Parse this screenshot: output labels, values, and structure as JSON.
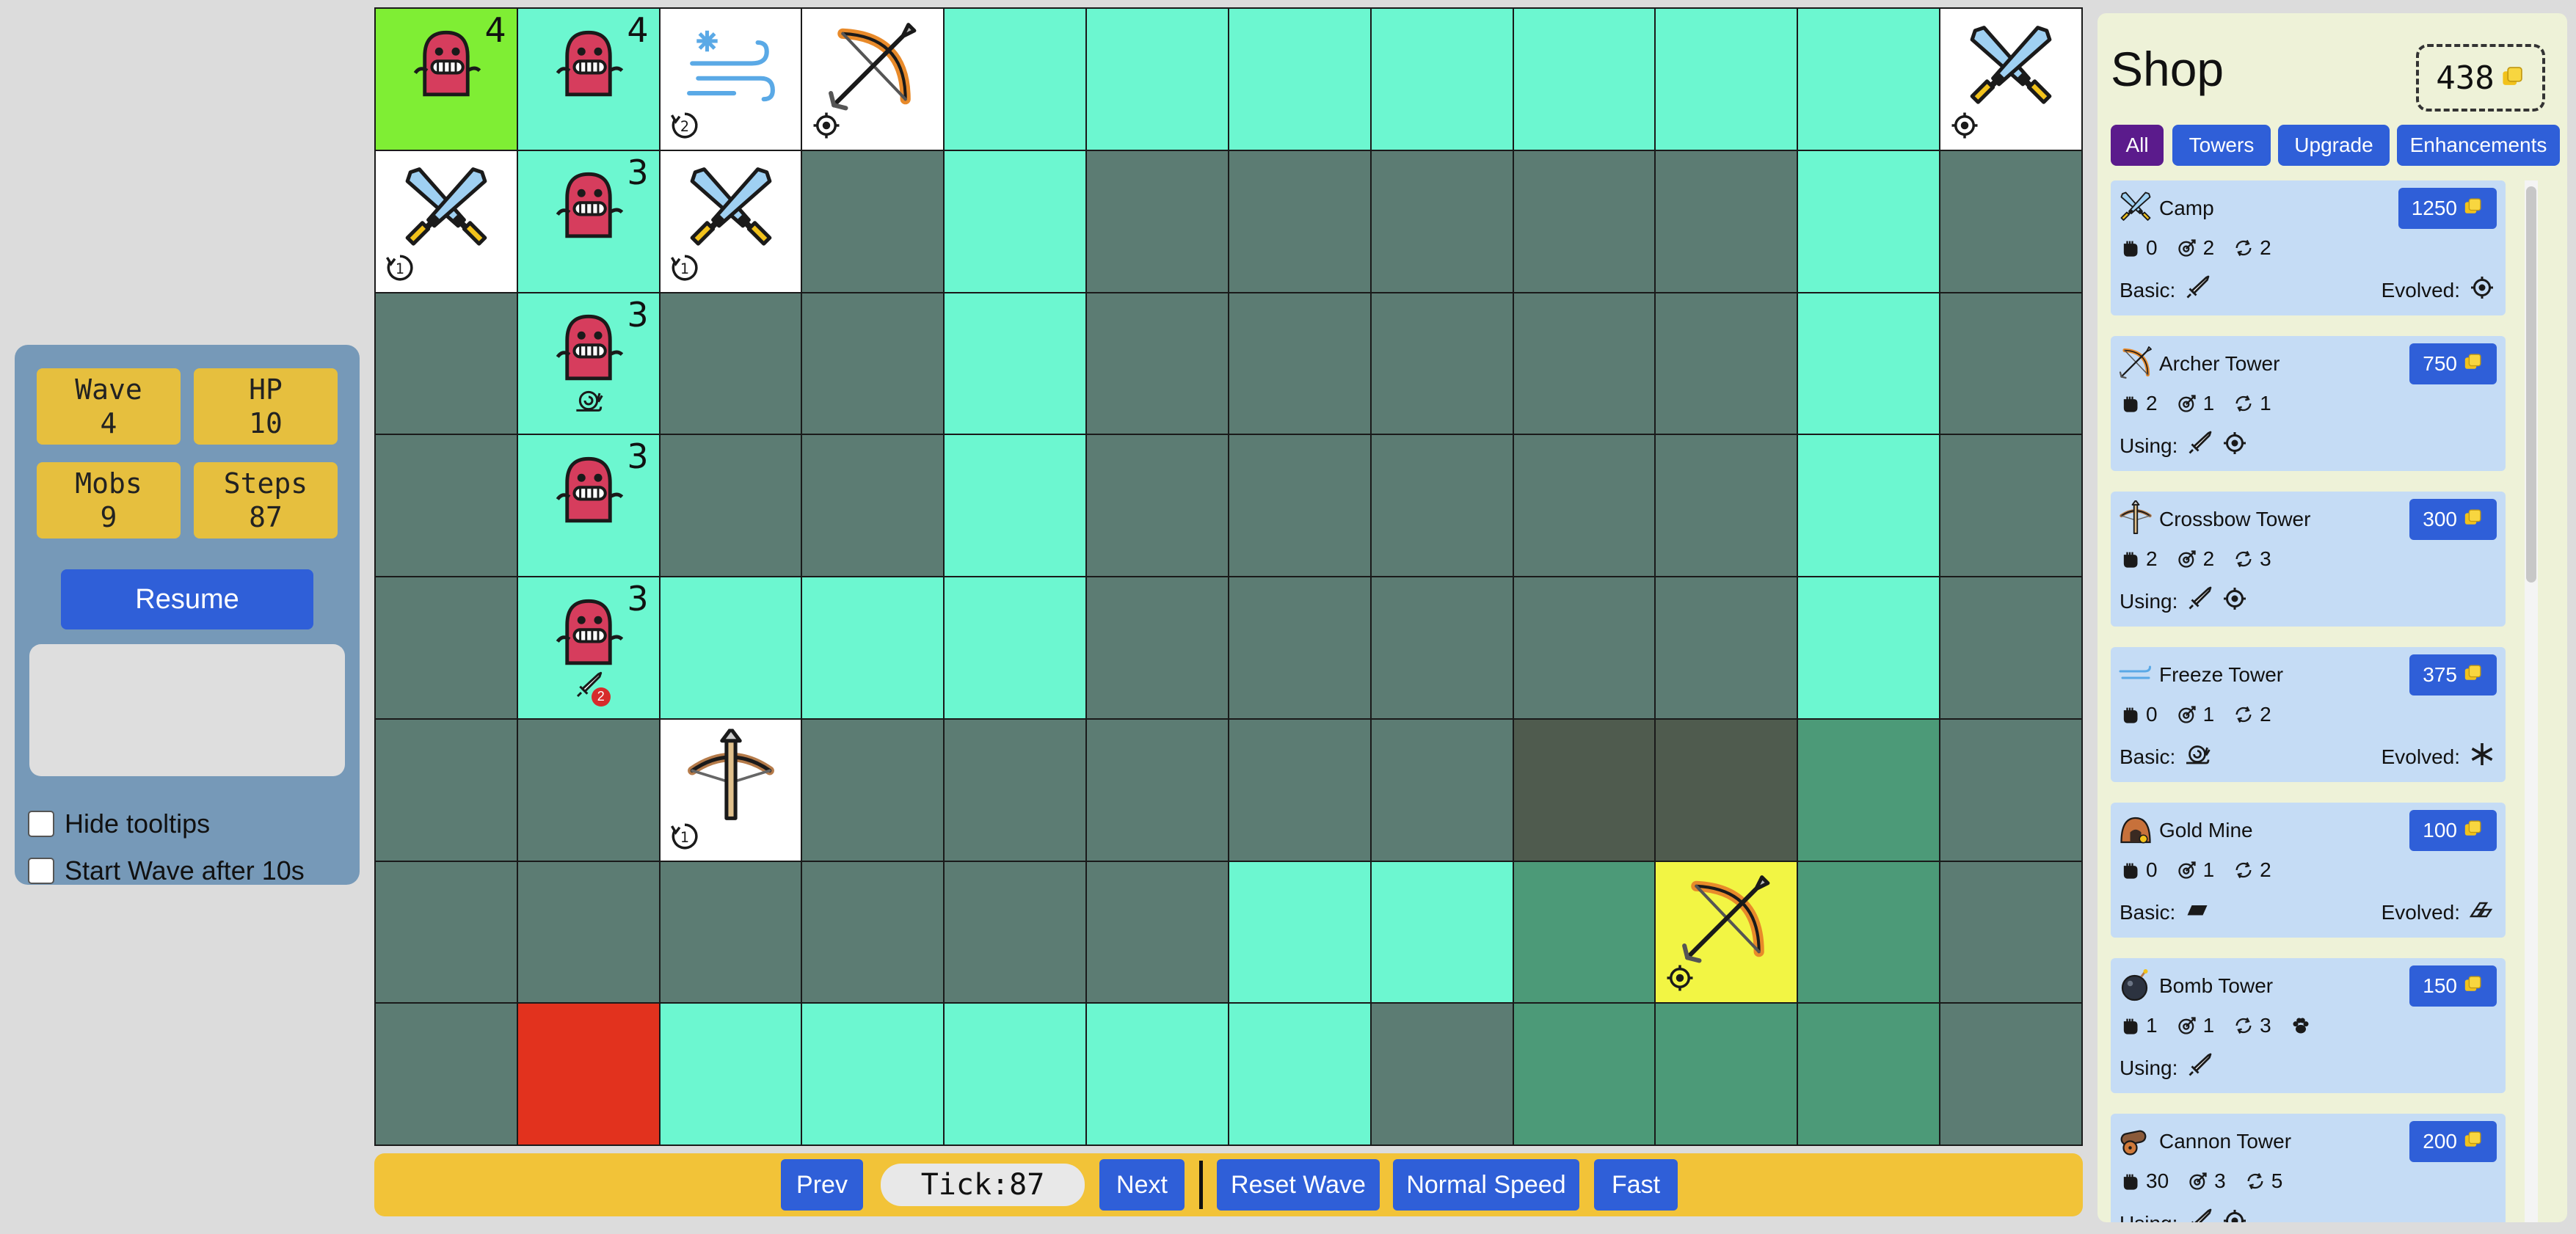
{
  "status": {
    "wave_label": "Wave",
    "wave_value": "4",
    "hp_label": "HP",
    "hp_value": "10",
    "mobs_label": "Mobs",
    "mobs_value": "9",
    "steps_label": "Steps",
    "steps_value": "87",
    "resume_label": "Resume",
    "hide_tooltips_label": "Hide tooltips",
    "start_wave_label": "Start Wave after 10s"
  },
  "board": {
    "columns": 12,
    "rows": [
      [
        {
          "tile": "start",
          "content": "mob",
          "count": "4"
        },
        {
          "tile": "path",
          "content": "mob",
          "count": "4"
        },
        {
          "tile": "tower",
          "content": "freeze-tower",
          "badge": "2"
        },
        {
          "tile": "tower",
          "content": "archer-tower",
          "badge": "target"
        },
        {
          "tile": "path"
        },
        {
          "tile": "path"
        },
        {
          "tile": "path"
        },
        {
          "tile": "path"
        },
        {
          "tile": "path"
        },
        {
          "tile": "path"
        },
        {
          "tile": "path"
        },
        {
          "tile": "tower",
          "content": "camp-tower",
          "badge": "target"
        }
      ],
      [
        {
          "tile": "tower",
          "content": "camp-tower",
          "badge": "1"
        },
        {
          "tile": "path",
          "content": "mob",
          "count": "3"
        },
        {
          "tile": "tower",
          "content": "camp-tower",
          "badge": "1"
        },
        {
          "tile": "ground"
        },
        {
          "tile": "path"
        },
        {
          "tile": "ground"
        },
        {
          "tile": "ground"
        },
        {
          "tile": "ground"
        },
        {
          "tile": "ground"
        },
        {
          "tile": "ground"
        },
        {
          "tile": "path"
        },
        {
          "tile": "ground"
        }
      ],
      [
        {
          "tile": "ground"
        },
        {
          "tile": "path",
          "content": "mob",
          "count": "3",
          "status": "slow"
        },
        {
          "tile": "ground"
        },
        {
          "tile": "ground"
        },
        {
          "tile": "path"
        },
        {
          "tile": "ground"
        },
        {
          "tile": "ground"
        },
        {
          "tile": "ground"
        },
        {
          "tile": "ground"
        },
        {
          "tile": "ground"
        },
        {
          "tile": "path"
        },
        {
          "tile": "ground"
        }
      ],
      [
        {
          "tile": "ground"
        },
        {
          "tile": "path",
          "content": "mob",
          "count": "3"
        },
        {
          "tile": "ground"
        },
        {
          "tile": "ground"
        },
        {
          "tile": "path"
        },
        {
          "tile": "ground"
        },
        {
          "tile": "ground"
        },
        {
          "tile": "ground"
        },
        {
          "tile": "ground"
        },
        {
          "tile": "ground"
        },
        {
          "tile": "path"
        },
        {
          "tile": "ground"
        }
      ],
      [
        {
          "tile": "ground"
        },
        {
          "tile": "path",
          "content": "mob",
          "count": "3",
          "status": "dagger",
          "status_count": "2"
        },
        {
          "tile": "path"
        },
        {
          "tile": "path"
        },
        {
          "tile": "path"
        },
        {
          "tile": "ground"
        },
        {
          "tile": "ground"
        },
        {
          "tile": "ground"
        },
        {
          "tile": "ground"
        },
        {
          "tile": "ground"
        },
        {
          "tile": "path"
        },
        {
          "tile": "ground"
        }
      ],
      [
        {
          "tile": "ground"
        },
        {
          "tile": "ground"
        },
        {
          "tile": "tower",
          "content": "crossbow-tower",
          "badge": "1"
        },
        {
          "tile": "ground"
        },
        {
          "tile": "ground"
        },
        {
          "tile": "ground"
        },
        {
          "tile": "ground"
        },
        {
          "tile": "ground"
        },
        {
          "tile": "olive"
        },
        {
          "tile": "olive"
        },
        {
          "tile": "green"
        },
        {
          "tile": "ground"
        }
      ],
      [
        {
          "tile": "ground"
        },
        {
          "tile": "ground"
        },
        {
          "tile": "ground"
        },
        {
          "tile": "ground"
        },
        {
          "tile": "ground"
        },
        {
          "tile": "ground"
        },
        {
          "tile": "path"
        },
        {
          "tile": "path"
        },
        {
          "tile": "green"
        },
        {
          "tile": "yellow",
          "content": "archer-tower",
          "badge": "target"
        },
        {
          "tile": "green"
        },
        {
          "tile": "ground"
        }
      ],
      [
        {
          "tile": "ground"
        },
        {
          "tile": "end"
        },
        {
          "tile": "path"
        },
        {
          "tile": "path"
        },
        {
          "tile": "path"
        },
        {
          "tile": "path"
        },
        {
          "tile": "path"
        },
        {
          "tile": "ground"
        },
        {
          "tile": "green"
        },
        {
          "tile": "green"
        },
        {
          "tile": "green"
        },
        {
          "tile": "ground"
        }
      ]
    ]
  },
  "controls": {
    "prev_label": "Prev",
    "tick_text": "Tick:87",
    "next_label": "Next",
    "reset_label": "Reset Wave",
    "normal_speed_label": "Normal Speed",
    "fast_label": "Fast"
  },
  "shop": {
    "title": "Shop",
    "gold": "438",
    "filters": [
      "All",
      "Towers",
      "Upgrade",
      "Enhancements"
    ],
    "active_filter": "All",
    "items": [
      {
        "name": "Camp",
        "icon": "camp-icon",
        "price": "1250",
        "damage": "0",
        "range": "2",
        "speed": "2",
        "left_label": "Basic:",
        "left_icons": [
          "dagger-icon"
        ],
        "right_label": "Evolved:",
        "right_icons": [
          "target-icon"
        ]
      },
      {
        "name": "Archer Tower",
        "icon": "archer-icon",
        "price": "750",
        "damage": "2",
        "range": "1",
        "speed": "1",
        "left_label": "Using:",
        "left_icons": [
          "dagger-icon",
          "target-icon"
        ]
      },
      {
        "name": "Crossbow Tower",
        "icon": "crossbow-icon",
        "price": "300",
        "damage": "2",
        "range": "2",
        "speed": "3",
        "left_label": "Using:",
        "left_icons": [
          "dagger-icon",
          "target-icon"
        ]
      },
      {
        "name": "Freeze Tower",
        "icon": "freeze-icon",
        "price": "375",
        "damage": "0",
        "range": "1",
        "speed": "2",
        "left_label": "Basic:",
        "left_icons": [
          "snail-icon"
        ],
        "right_label": "Evolved:",
        "right_icons": [
          "snowflake-icon"
        ]
      },
      {
        "name": "Gold Mine",
        "icon": "gold-mine-icon",
        "price": "100",
        "damage": "0",
        "range": "1",
        "speed": "2",
        "left_label": "Basic:",
        "left_icons": [
          "gold-bar-icon"
        ],
        "right_label": "Evolved:",
        "right_icons": [
          "gold-pile-icon"
        ]
      },
      {
        "name": "Bomb Tower",
        "icon": "bomb-icon",
        "price": "150",
        "damage": "1",
        "range": "1",
        "speed": "3",
        "extra": "paw-icon",
        "left_label": "Using:",
        "left_icons": [
          "dagger-icon"
        ]
      },
      {
        "name": "Cannon Tower",
        "icon": "cannon-icon",
        "price": "200",
        "damage": "30",
        "range": "3",
        "speed": "5",
        "left_label": "Using:",
        "left_icons": [
          "dagger-icon",
          "target-icon"
        ]
      }
    ]
  },
  "colors": {
    "button_blue": "#2f5fd8",
    "active_filter": "#5b1b8c",
    "stat_yellow": "#e6bf3e",
    "panel_blue": "#7699b8",
    "path": "#6cf7d0",
    "ground": "#5c7c73",
    "start": "#7fee34",
    "end": "#e2321e"
  }
}
